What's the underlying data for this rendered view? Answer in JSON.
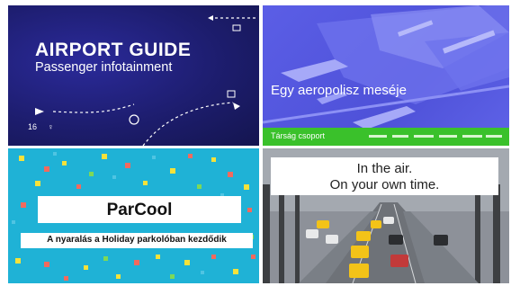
{
  "tiles": [
    {
      "title": "AIRPORT GUIDE",
      "subtitle": "Passenger infotainment",
      "colors": {
        "background": "#1d1d6e",
        "accent": "#ffffff"
      }
    },
    {
      "title": "Egy aeropolisz meséje",
      "bar_label": "Társág csoport",
      "colors": {
        "background": "#5b5ee6",
        "bar": "#3ac12b"
      }
    },
    {
      "title": "ParCool",
      "subtitle": "A nyaralás a Holiday parkolóban kezdődik",
      "colors": {
        "background": "#1fb2d6",
        "dots": [
          "#f5e23a",
          "#f26a5e",
          "#7ed957"
        ]
      }
    },
    {
      "line1": "In the air.",
      "line2": "On your own time.",
      "colors": {
        "background": "#8d9199",
        "taxi": "#f3c318"
      }
    }
  ]
}
